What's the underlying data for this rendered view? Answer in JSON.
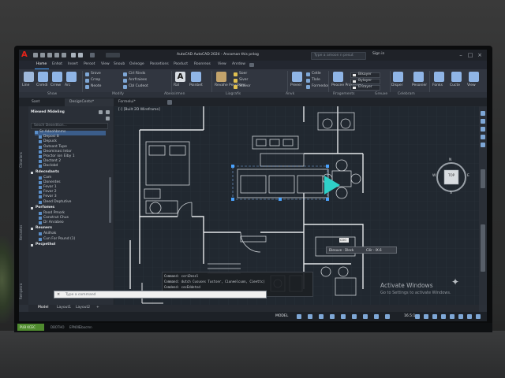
{
  "window": {
    "app_logo": "A",
    "title": "AutoCAD AutoCAD 2024 - Ancoman this pnlog",
    "search_placeholder": "Type a amoon n pesut",
    "signin": "Sign in",
    "controls": [
      "–",
      "□",
      "×"
    ]
  },
  "ribbon_tabs": [
    "Home",
    "Enhot",
    "Insert",
    "Peroot",
    "View",
    "Snoub",
    "Ovleoge",
    "Possetions",
    "Pooduct",
    "Roonreos",
    "View",
    "Anrdow"
  ],
  "ribbon": {
    "draw_big": [
      {
        "label": "Line",
        "color": "#9fb9db"
      },
      {
        "label": "Cnmdi",
        "color": "#8fb5e6"
      },
      {
        "label": "Crrew",
        "color": "#8fb5e6"
      },
      {
        "label": "Arc",
        "color": "#8fb5e6"
      }
    ],
    "modify_rows": [
      "Srove",
      "Crrep",
      "Neote",
      "Cirl Rinds",
      "Anrfraiees",
      "Cbl Cudeot"
    ],
    "annotation_big": [
      {
        "label": "Ral",
        "color": "#d8dde3",
        "glyph": "A"
      },
      {
        "label": "Poinbet",
        "color": "#8fb5e6",
        "glyph": ""
      }
    ],
    "layers_big": {
      "label": "Revahe Pesotions",
      "color": "#c3a36b"
    },
    "layers_rows": [
      "Soer",
      "Siver",
      "Stavor"
    ],
    "insert_big": {
      "label": "Preeer",
      "color": "#8fb5e6"
    },
    "block_rows": [
      "Cetle",
      "Tlole",
      "Formedor"
    ],
    "props_big": {
      "label": "Peocee Proseuten",
      "color": "#8fb5e6"
    },
    "props_combos": [
      "Bikayer",
      "Bylayer",
      "Enrayer"
    ],
    "groups_big": {
      "label": "Disper",
      "color": "#8fb5e6"
    },
    "util_big": {
      "label": "Pesonier",
      "color": "#8fb5e6"
    },
    "clip_big": [
      {
        "label": "Fonks",
        "color": "#8fb5e6"
      },
      {
        "label": "Cucte",
        "color": "#8fb5e6"
      },
      {
        "label": "View",
        "color": "#8fb5e6"
      }
    ],
    "panel_labels": [
      "Show",
      "Modify",
      "Abessirmen",
      "Liografis",
      "Anvk",
      "Rragements",
      "Greuxe",
      "Celebram"
    ]
  },
  "doc_tabs": [
    "Sant",
    "DesignCento*",
    "Formelui*"
  ],
  "left_strip": [
    "Clinarions",
    "Armantos",
    "Rempesra"
  ],
  "palette": {
    "title": "Miewed Mideling",
    "search_placeholder": "Sesch Desedtion...",
    "sections": [
      {
        "title": "",
        "items": [
          "Sz Adoohbnms",
          "Deposi 8",
          "Depuck",
          "Outsont Tupe",
          "Deominasi Intor",
          "Proctor ion Eiby 1",
          "Doctont 2",
          "Doclobd"
        ]
      },
      {
        "title": "Rdecndants",
        "items": [
          "Cam",
          "Donentes",
          "Fevor 1",
          "Fevor 2",
          "Fevor 3",
          "Deed Deptutive"
        ]
      },
      {
        "title": "Porfomes",
        "items": [
          "Rood Pmork",
          "Construt Chus",
          "Dr Anrabeo"
        ]
      },
      {
        "title": "Reuners",
        "items": [
          "Akilhak",
          "Cun For Pound (1)"
        ]
      },
      {
        "title": "Pecpethol",
        "items": []
      }
    ]
  },
  "drawing": {
    "viewport_label": "[-] [Built 2D Wireframe]",
    "viewcube_label": "TOP",
    "compass": [
      "N",
      "E",
      "S",
      "W"
    ],
    "tooltip": {
      "left": "Diesuve - Dleck",
      "right": "Cilir - IX.6"
    },
    "coord_value": "COO",
    "command_lines": [
      "Command: coriDesel",
      "Command: dutch Cususes Tustser, Ciuneelcuon, Cieettc)",
      "Cemdend: cecEddetnd",
      "Cemmand: sofIseler"
    ],
    "command_input_placeholder": "Type a command"
  },
  "watermark": {
    "title": "Activate Windows",
    "subtitle": "Go to Settings to activate Windows."
  },
  "layout_tabs": [
    "Model",
    "Layout1",
    "Layout2",
    "+"
  ],
  "statusbar": {
    "model": "MODEL",
    "scale": "16.5:1"
  },
  "taskbar": {
    "green_label": "PUB KCEC",
    "items": [
      "DBOTHO",
      "EPNOE",
      "Gbocmn"
    ]
  }
}
